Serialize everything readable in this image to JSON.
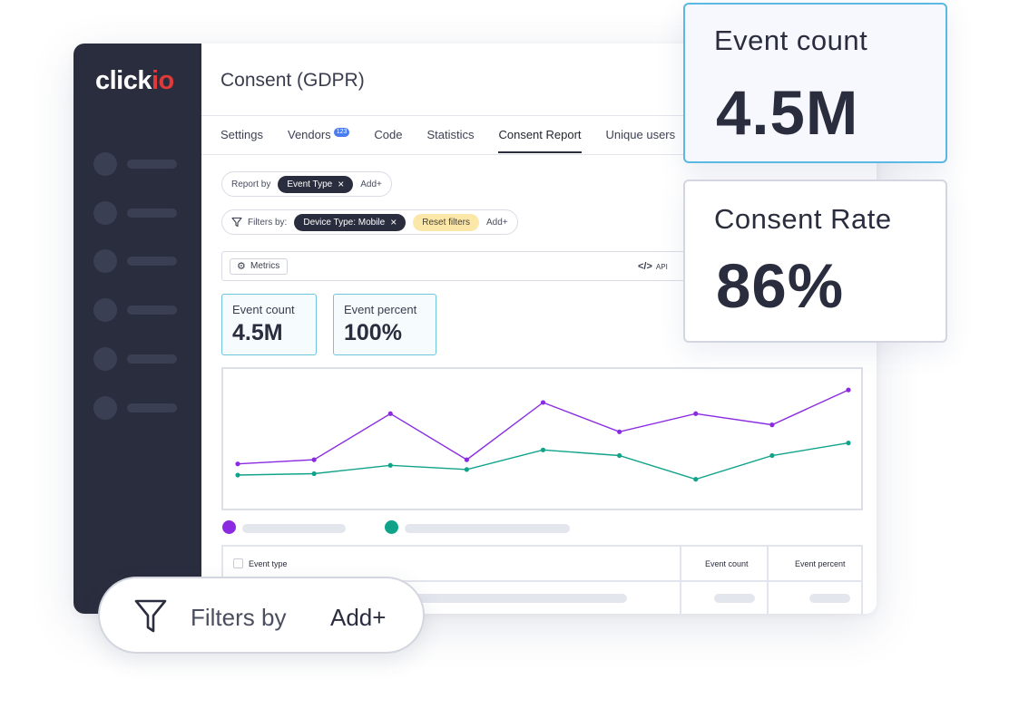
{
  "sidebar": {
    "logo": {
      "text_main": "click",
      "text_accent": "io"
    },
    "items_count": 6
  },
  "header": {
    "title": "Consent (GDPR)"
  },
  "tabs": [
    {
      "label": "Settings"
    },
    {
      "label": "Vendors",
      "badge": "123"
    },
    {
      "label": "Code"
    },
    {
      "label": "Statistics"
    },
    {
      "label": "Consent Report",
      "active": true
    },
    {
      "label": "Unique users"
    }
  ],
  "report_by": {
    "label": "Report by",
    "chip": "Event Type",
    "add": "Add+"
  },
  "filters": {
    "label": "Filters by:",
    "chip": "Device Type: Mobile",
    "reset": "Reset filters",
    "add": "Add+"
  },
  "toolbar": {
    "metrics_label": "Metrics",
    "api_code": "</>",
    "api_label": "API"
  },
  "kpis": [
    {
      "label": "Event count",
      "value": "4.5M"
    },
    {
      "label": "Event percent",
      "value": "100%"
    }
  ],
  "chart_data": {
    "type": "line",
    "x": [
      1,
      2,
      3,
      4,
      5,
      6,
      7,
      8,
      9
    ],
    "ylim": [
      0,
      100
    ],
    "series": [
      {
        "color": "#8a2be2",
        "values": [
          32,
          35,
          68,
          35,
          76,
          55,
          68,
          60,
          85
        ]
      },
      {
        "color": "#10a38a",
        "values": [
          24,
          25,
          31,
          28,
          42,
          38,
          21,
          38,
          47
        ]
      }
    ]
  },
  "table": {
    "columns": [
      "Event type",
      "Event count",
      "Event percent"
    ]
  },
  "cards": [
    {
      "label": "Event count",
      "value": "4.5M"
    },
    {
      "label": "Consent Rate",
      "value": "86%"
    }
  ],
  "floating_filter": {
    "label": "Filters by",
    "add": "Add+"
  },
  "colors": {
    "sidebar": "#2a2d3e",
    "accent_blue": "#5bb8e3",
    "series_purple": "#8a2be2",
    "series_green": "#10a38a",
    "reset_chip": "#fbe7a8"
  }
}
